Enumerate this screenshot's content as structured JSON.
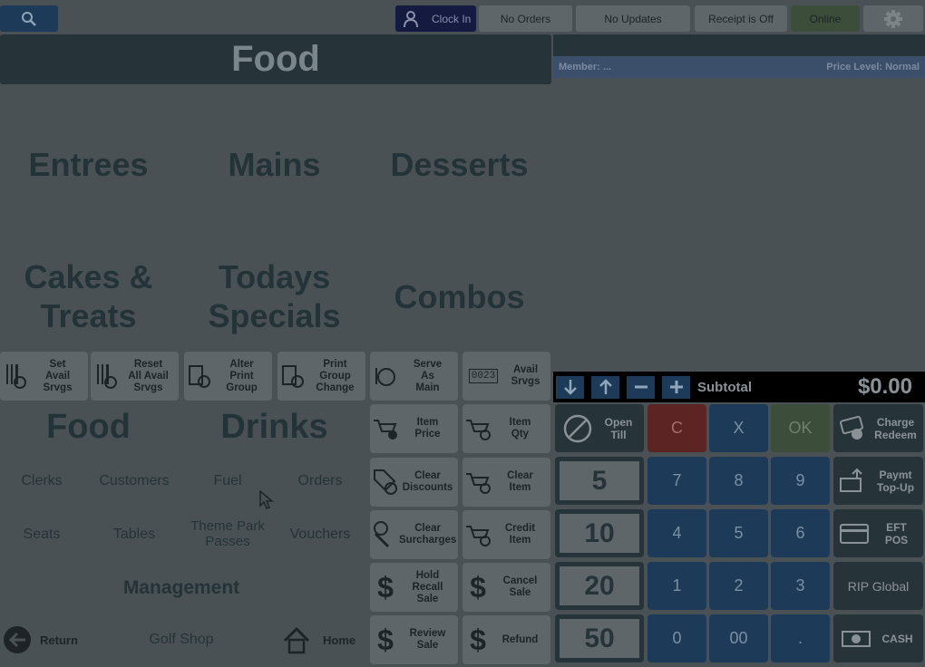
{
  "topbar": {
    "clock_in": "Clock In",
    "orders": "No Orders",
    "updates": "No Updates",
    "receipt": "Receipt is Off",
    "online": "Online"
  },
  "header": {
    "title": "Food"
  },
  "order_panel": {
    "member": "Member: ...",
    "price_level": "Price Level: Normal"
  },
  "categories": {
    "entrees": "Entrees",
    "mains": "Mains",
    "desserts": "Desserts",
    "cakes": "Cakes &\nTreats",
    "specials": "Todays\nSpecials",
    "combos": "Combos",
    "food": "Food",
    "drinks": "Drinks"
  },
  "menu_links": {
    "clerks": "Clerks",
    "customers": "Customers",
    "fuel": "Fuel",
    "orders": "Orders",
    "seats": "Seats",
    "tables": "Tables",
    "theme_park": "Theme Park\nPasses",
    "vouchers": "Vouchers",
    "management": "Management",
    "return": "Return",
    "golf_shop": "Golf Shop",
    "home": "Home"
  },
  "func_row": {
    "set_avail": "Set\nAvail\nSrvgs",
    "reset_avail": "Reset\nAll Avail\nSrvgs",
    "alter_print": "Alter\nPrint\nGroup",
    "print_change": "Print\nGroup\nChange",
    "serve_as_main": "Serve\nAs\nMain",
    "avail_srvgs": "Avail\nSrvgs",
    "avail_counter": "0023"
  },
  "item_buttons": {
    "item_price": "Item\nPrice",
    "item_qty": "Item\nQty",
    "clear_discounts": "Clear\nDiscounts",
    "clear_item": "Clear\nItem",
    "clear_surcharges": "Clear\nSurcharges",
    "credit_item": "Credit\nItem",
    "hold_recall": "Hold\nRecall\nSale",
    "cancel_sale": "Cancel\nSale",
    "review_sale": "Review\nSale",
    "refund": "Refund"
  },
  "totals": {
    "label": "Subtotal",
    "amount": "$0.00"
  },
  "keypad": {
    "open_till": "Open\nTill",
    "c": "C",
    "x": "X",
    "ok": "OK",
    "k7": "7",
    "k8": "8",
    "k9": "9",
    "k4": "4",
    "k5": "5",
    "k6": "6",
    "k1": "1",
    "k2": "2",
    "k3": "3",
    "k0": "0",
    "k00": "00",
    "kdot": ".",
    "note5": "5",
    "note10": "10",
    "note20": "20",
    "note50": "50"
  },
  "right_buttons": {
    "charge": "Charge\nRedeem",
    "paymt": "Paymt\nTop-Up",
    "eft": "EFT\nPOS",
    "rip": "RIP Global",
    "cash": "CASH"
  },
  "colors": {
    "background": "#4a5155",
    "header": "#263338",
    "blue_key": "#1d3a58",
    "red_key": "#5c2422",
    "green_key": "#3c4d3a",
    "clock_in": "#151a40",
    "search": "#1d3a58"
  }
}
